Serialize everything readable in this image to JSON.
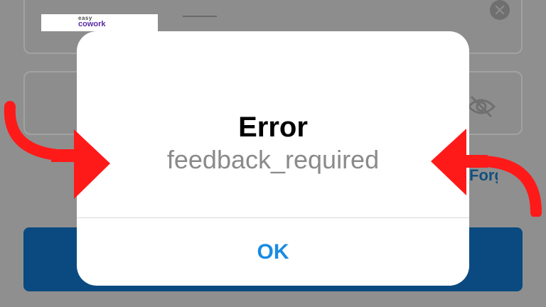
{
  "logo": {
    "top_text": "easy",
    "main_text": "cowork"
  },
  "background": {
    "forgot_link_text": "Forgot password?"
  },
  "dialog": {
    "title": "Error",
    "message": "feedback_required",
    "button_label": "OK"
  },
  "colors": {
    "overlay": "#8f8f8f",
    "button_blue": "#1a8be3",
    "arrow_red": "#ff1a1a"
  },
  "icons": [
    "clear-icon",
    "eye-slash-icon",
    "arrow-right-icon",
    "arrow-left-icon"
  ]
}
